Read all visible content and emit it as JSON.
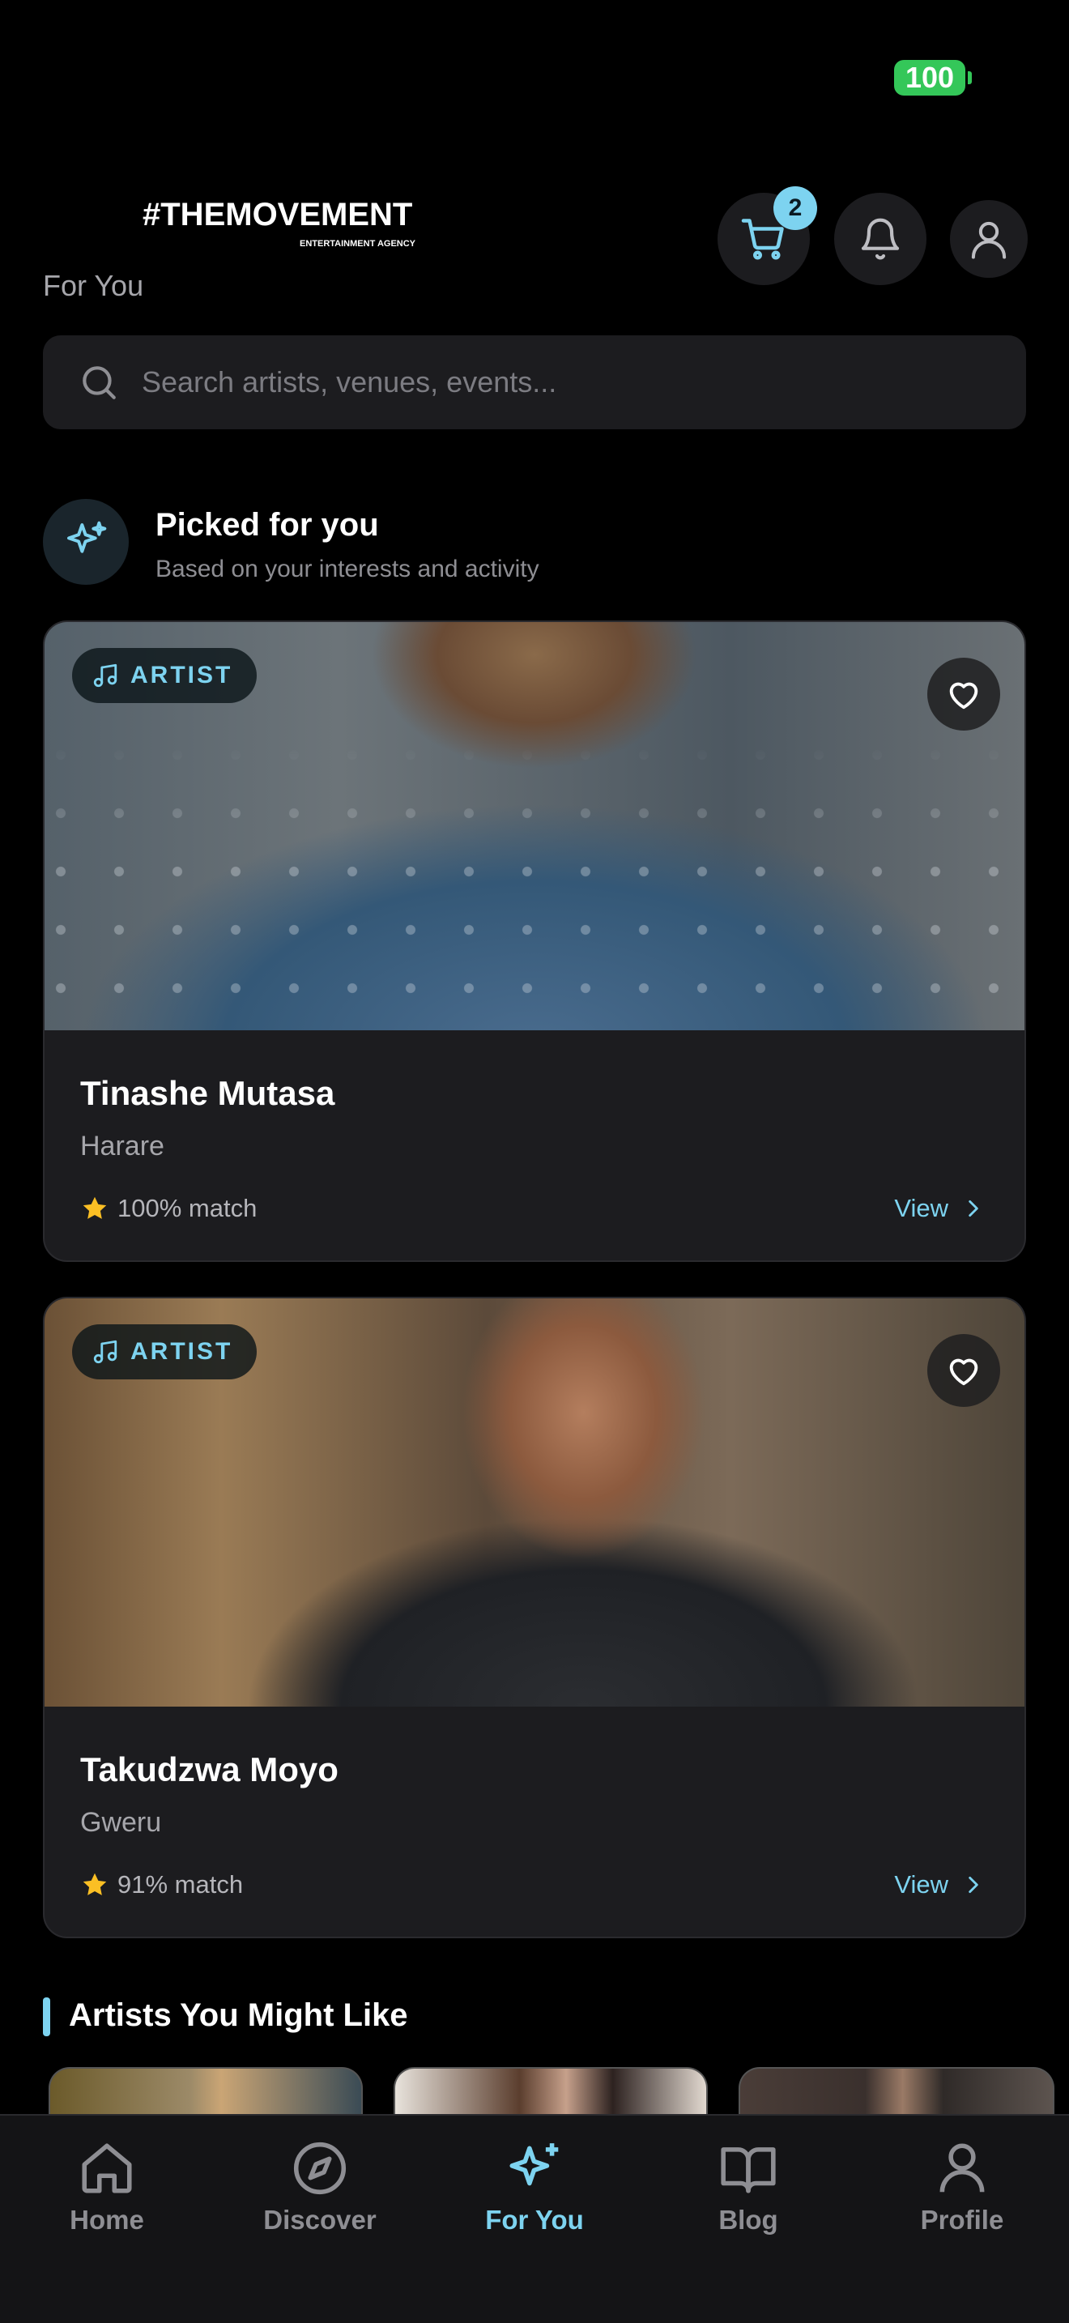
{
  "status_bar": {
    "battery": "100"
  },
  "header": {
    "logo_text": "#THEMOVEMENT",
    "logo_tagline": "ENTERTAINMENT AGENCY",
    "page_title": "For You",
    "cart_count": "2"
  },
  "search": {
    "placeholder": "Search artists, venues, events..."
  },
  "picked": {
    "title": "Picked for you",
    "subtitle": "Based on your interests and activity"
  },
  "cards": [
    {
      "tag": "ARTIST",
      "name": "Tinashe Mutasa",
      "city": "Harare",
      "match": "100% match",
      "action": "View"
    },
    {
      "tag": "ARTIST",
      "name": "Takudzwa Moyo",
      "city": "Gweru",
      "match": "91% match",
      "action": "View"
    }
  ],
  "artists_section": {
    "title": "Artists You Might Like"
  },
  "tabbar": {
    "tabs": [
      {
        "label": "Home",
        "icon": "home-icon"
      },
      {
        "label": "Discover",
        "icon": "compass-icon"
      },
      {
        "label": "For You",
        "icon": "sparkles-icon",
        "active": true
      },
      {
        "label": "Blog",
        "icon": "book-icon"
      },
      {
        "label": "Profile",
        "icon": "user-icon"
      }
    ]
  },
  "colors": {
    "accent": "#7dd3f0",
    "background": "#000000",
    "card": "#1c1c1f",
    "star": "#fbbf24",
    "battery": "#34c759"
  }
}
